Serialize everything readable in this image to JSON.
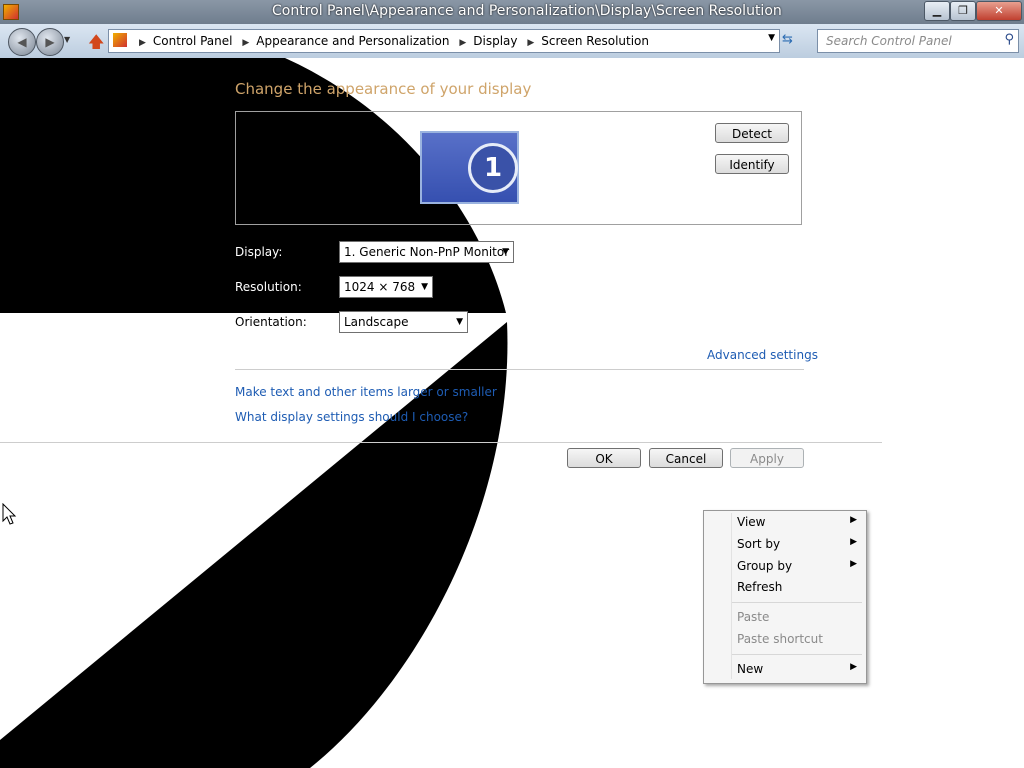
{
  "window": {
    "title": "Control Panel\\Appearance and Personalization\\Display\\Screen Resolution",
    "minimize": "▁",
    "maximize": "❐",
    "close": "✕"
  },
  "navbar": {
    "back_icon": "back-arrow-icon",
    "forward_icon": "forward-arrow-icon",
    "breadcrumbs": [
      "Control Panel",
      "Appearance and Personalization",
      "Display",
      "Screen Resolution"
    ],
    "search_placeholder": "Search Control Panel"
  },
  "main": {
    "heading": "Change the appearance of your display",
    "monitor_number": "1",
    "detect_label": "Detect",
    "identify_label": "Identify",
    "display_label": "Display:",
    "display_value": "1. Generic Non-PnP Monitor",
    "resolution_label": "Resolution:",
    "resolution_value": "1024 × 768",
    "orientation_label": "Orientation:",
    "orientation_value": "Landscape",
    "advanced_link": "Advanced settings",
    "text_size_link": "Make text and other items larger or smaller",
    "help_link": "What display settings should I choose?",
    "ok_label": "OK",
    "cancel_label": "Cancel",
    "apply_label": "Apply"
  },
  "context_menu": {
    "items": [
      {
        "label": "View",
        "submenu": true,
        "enabled": true
      },
      {
        "label": "Sort by",
        "submenu": true,
        "enabled": true
      },
      {
        "label": "Group by",
        "submenu": true,
        "enabled": true
      },
      {
        "label": "Refresh",
        "submenu": false,
        "enabled": true
      },
      {
        "label": "Paste",
        "submenu": false,
        "enabled": false
      },
      {
        "label": "Paste shortcut",
        "submenu": false,
        "enabled": false
      },
      {
        "label": "New",
        "submenu": true,
        "enabled": true
      }
    ]
  },
  "colors": {
    "heading": "#cfa46a",
    "link": "#1e5cb3",
    "overlay": "#000000"
  }
}
